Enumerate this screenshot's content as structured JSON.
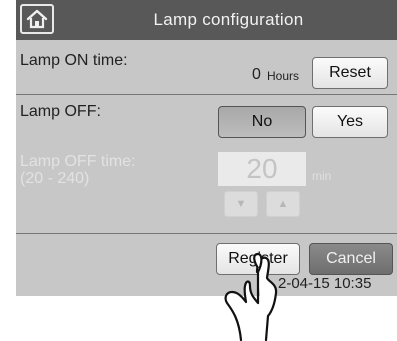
{
  "header": {
    "title": "Lamp configuration",
    "home_icon": "home-icon"
  },
  "lamp_on": {
    "label": "Lamp ON time:",
    "value": "0",
    "unit": "Hours",
    "reset_label": "Reset"
  },
  "lamp_off": {
    "label": "Lamp OFF:",
    "no_label": "No",
    "yes_label": "Yes",
    "selected": "No"
  },
  "lamp_off_time": {
    "label_line1": "Lamp OFF time:",
    "label_line2": "(20 - 240)",
    "value": "20",
    "unit": "min",
    "down_icon": "triangle-down-icon",
    "up_icon": "triangle-up-icon"
  },
  "footer": {
    "register_label": "Register",
    "cancel_label": "Cancel",
    "datetime": "2-04-15 10:35"
  },
  "colors": {
    "screen_bg": "#c7c7c7",
    "titlebar_bg": "#585858",
    "pressed_bg": "#a8a8a8",
    "cancel_bg": "#7a7a7a"
  }
}
